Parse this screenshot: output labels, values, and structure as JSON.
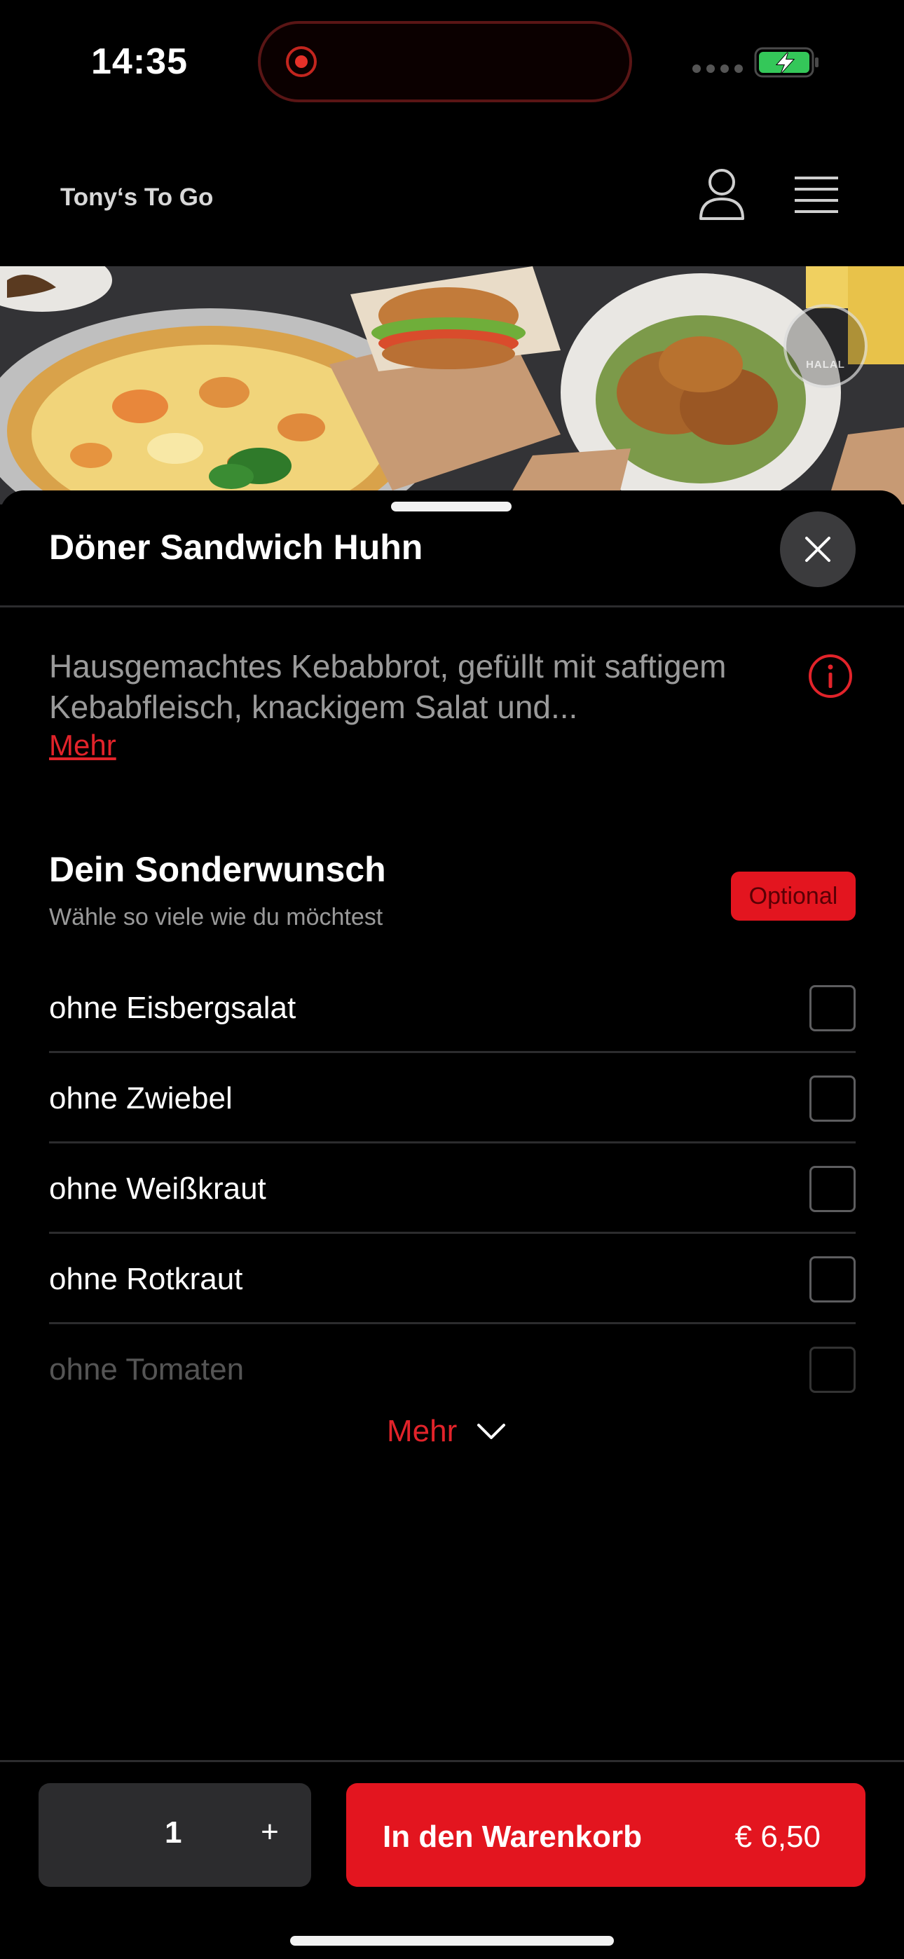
{
  "status_bar": {
    "time": "14:35"
  },
  "header": {
    "brand": "Tony‘s To Go"
  },
  "hero": {
    "badge_text": "HALAL"
  },
  "product": {
    "title": "Döner Sandwich Huhn",
    "description": "Hausgemachtes Kebabbrot, gefüllt mit saftigem Kebabfleisch, knackigem Salat und...",
    "more_link": "Mehr"
  },
  "options_section": {
    "title": "Dein Sonderwunsch",
    "subtitle": "Wähle so viele wie du möchtest",
    "badge": "Optional",
    "items": [
      {
        "label": "ohne Eisbergsalat",
        "checked": false
      },
      {
        "label": "ohne Zwiebel",
        "checked": false
      },
      {
        "label": "ohne Weißkraut",
        "checked": false
      },
      {
        "label": "ohne Rotkraut",
        "checked": false
      },
      {
        "label": "ohne Tomaten",
        "checked": false
      }
    ],
    "more_toggle": "Mehr"
  },
  "bottom_bar": {
    "quantity": "1",
    "plus": "+",
    "cart_label": "In den Warenkorb",
    "price": "€ 6,50"
  },
  "colors": {
    "accent": "#e3151f",
    "background": "#000000",
    "muted_text": "#9a9a9a"
  },
  "icons": [
    "recording-icon",
    "battery-charging-icon",
    "user-icon",
    "menu-icon",
    "close-icon",
    "info-icon",
    "chevron-down-icon"
  ]
}
